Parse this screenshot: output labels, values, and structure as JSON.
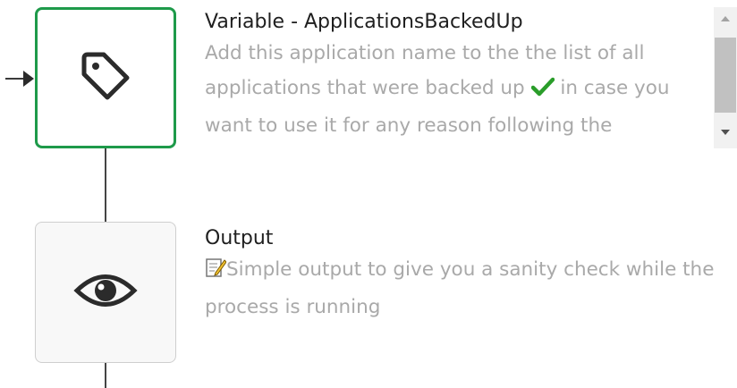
{
  "nodes": [
    {
      "title": "Variable - ApplicationsBackedUp",
      "description_parts": [
        "Add this application name to the the list of all applications that were backed up",
        " in case you want to use it for any reason following the"
      ],
      "icon": "tag-icon",
      "selected": true,
      "border_color": "#1e9a4a"
    },
    {
      "title": "Output",
      "description": "Simple output to give you a sanity check while the process is running",
      "icon": "eye-icon",
      "selected": false
    }
  ],
  "colors": {
    "title_text": "#1f1f1f",
    "description_text": "#a9a9a9",
    "check_mark": "#2a9d2a"
  }
}
